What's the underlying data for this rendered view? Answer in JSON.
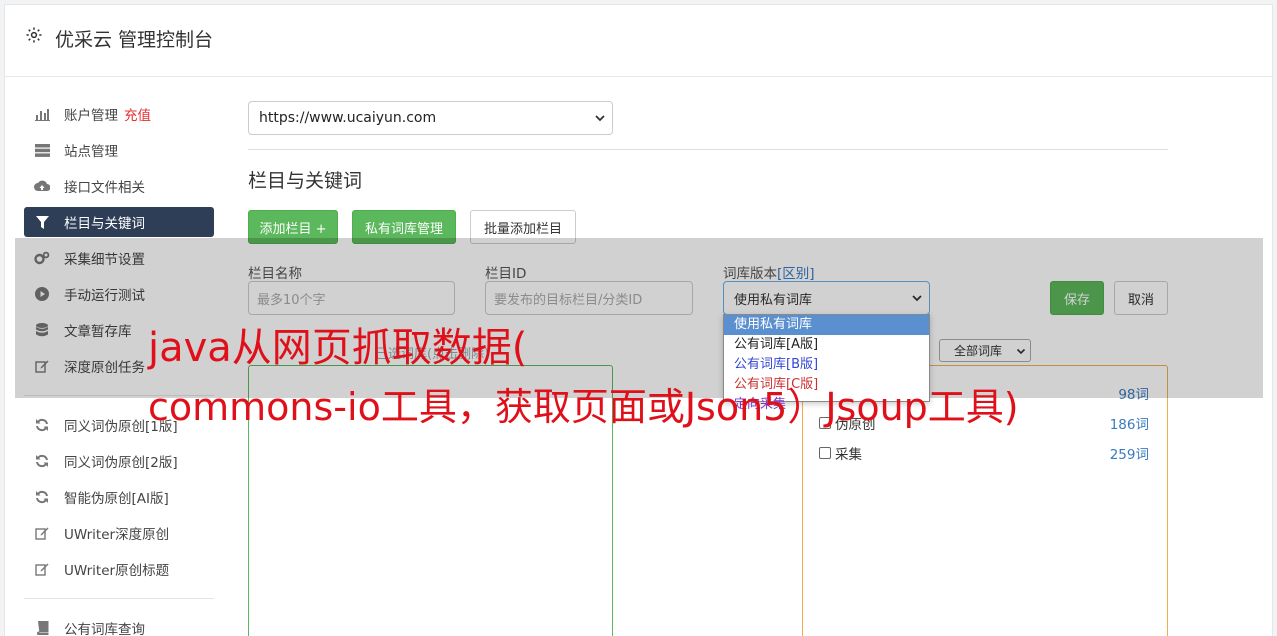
{
  "header": {
    "title": "优采云 管理控制台",
    "icon": "gear-icon"
  },
  "sidebar": {
    "items": [
      {
        "label": "账户管理",
        "badge": "充值",
        "icon": "bar-chart-icon"
      },
      {
        "label": "站点管理",
        "icon": "server-icon"
      },
      {
        "label": "接口文件相关",
        "icon": "cloud-upload-icon"
      },
      {
        "label": "栏目与关键词",
        "icon": "filter-icon",
        "active": true
      },
      {
        "label": "采集细节设置",
        "icon": "gears-icon"
      },
      {
        "label": "手动运行测试",
        "icon": "play-circle-icon"
      },
      {
        "label": "文章暂存库",
        "icon": "database-icon"
      },
      {
        "label": "深度原创任务",
        "icon": "edit-icon"
      }
    ],
    "items2": [
      {
        "label": "同义词伪原创[1版]",
        "icon": "refresh-icon"
      },
      {
        "label": "同义词伪原创[2版]",
        "icon": "refresh-icon"
      },
      {
        "label": "智能伪原创[AI版]",
        "icon": "refresh-icon"
      },
      {
        "label": "UWriter深度原创",
        "icon": "edit-icon"
      },
      {
        "label": "UWriter原创标题",
        "icon": "edit-icon"
      }
    ],
    "items3": [
      {
        "label": "公有词库查询",
        "icon": "book-icon"
      }
    ]
  },
  "main": {
    "site_select": "https://www.ucaiyun.com",
    "section_title": "栏目与关键词",
    "buttons": {
      "add_column": "添加栏目 +",
      "private_lib": "私有词库管理",
      "batch_add": "批量添加栏目"
    },
    "form": {
      "name_label": "栏目名称",
      "name_placeholder": "最多10个字",
      "id_label": "栏目ID",
      "id_placeholder": "要发布的目标栏目/分类ID",
      "version_label": "词库版本",
      "version_diff": "[区别]",
      "version_value": "使用私有词库",
      "save": "保存",
      "cancel": "取消"
    },
    "dropdown_options": [
      "使用私有词库",
      "公有词库[A版]",
      "公有词库[B版]",
      "公有词库[C版]",
      "定向采集"
    ],
    "hidden_label": "已选词库(点击删除)",
    "wordlib_filter": "全部词库",
    "wordlibs": [
      {
        "name": "",
        "count": "98词"
      },
      {
        "name": "伪原创",
        "count": "186词"
      },
      {
        "name": "采集",
        "count": "259词"
      }
    ]
  },
  "watermark": {
    "line1": "java从网页抓取数据(",
    "line2": "commons-io工具，获取页面或Json5）Jsoup工具)"
  }
}
